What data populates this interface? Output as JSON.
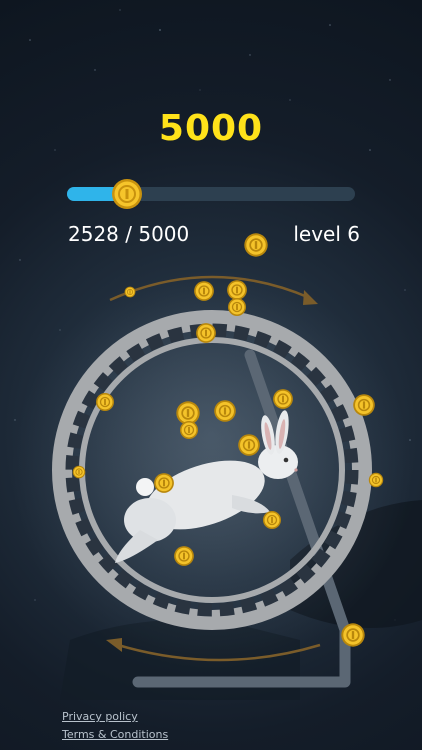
{
  "score": {
    "value": "5000"
  },
  "progress": {
    "current": 2528,
    "target": 5000,
    "fraction": 0.506,
    "text": "2528 / 5000"
  },
  "level": {
    "label": "level 6"
  },
  "footer": {
    "privacy": "Privacy policy",
    "terms": "Terms & Conditions"
  },
  "colors": {
    "score": "#ffe21a",
    "progress_fill": "#2fb4ea",
    "coin": "#f5c52a",
    "wheel": "#a7aaad"
  },
  "icons": {
    "coin": "coin-icon",
    "rabbit": "rabbit-icon",
    "wheel": "hamster-wheel-icon",
    "arrow": "curved-arrow-icon"
  }
}
